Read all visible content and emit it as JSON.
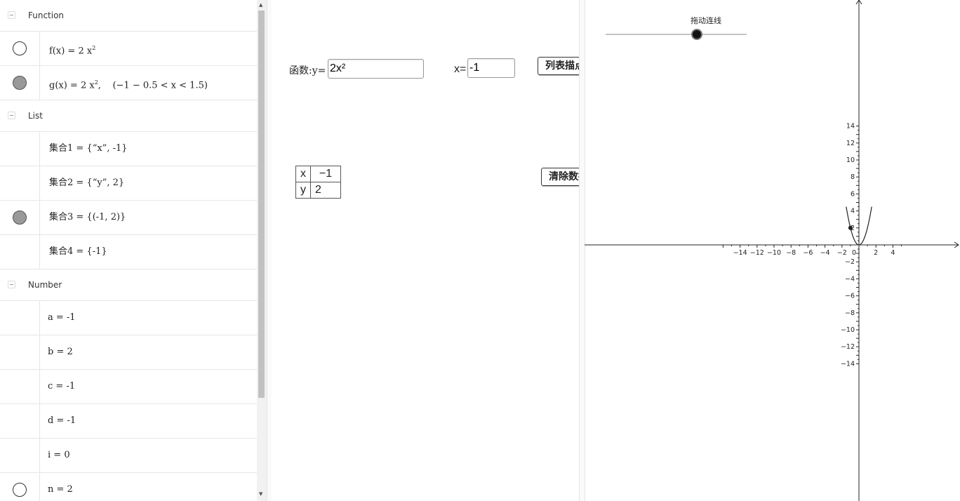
{
  "algebra": {
    "groups": {
      "function": "Function",
      "list": "List",
      "number": "Number"
    },
    "functions": [
      {
        "name": "f(x) = 2 x",
        "exp": "2",
        "rest": "",
        "visible": false
      },
      {
        "name": "g(x) = 2 x",
        "exp": "2",
        "rest": ",    (−1 − 0.5 < x < 1.5)",
        "visible": true
      }
    ],
    "lists": [
      {
        "text": "集合1 = {“x”, -1}",
        "visible": null
      },
      {
        "text": "集合2 = {“y”, 2}",
        "visible": null
      },
      {
        "text": "集合3 = {(-1, 2)}",
        "visible": true
      },
      {
        "text": "集合4 = {-1}",
        "visible": null
      }
    ],
    "numbers": [
      {
        "text": "a = -1",
        "visible": null
      },
      {
        "text": "b = 2",
        "visible": null
      },
      {
        "text": "c = -1",
        "visible": null
      },
      {
        "text": "d = -1",
        "visible": null
      },
      {
        "text": "i = 0",
        "visible": null
      },
      {
        "text": "n = 2",
        "visible": false
      }
    ]
  },
  "panel": {
    "function_label": "函数:y=",
    "function_value": "2x²",
    "x_label": "x=",
    "x_value": "-1",
    "plot_button": "列表描点",
    "clear_button": "清除数据",
    "table": {
      "headers": [
        "x",
        "y"
      ],
      "values": [
        "−1",
        "2"
      ]
    }
  },
  "graph": {
    "slider_caption": "拖动连线",
    "x_ticks": [
      "−14",
      "−12",
      "−10",
      "−8",
      "−6",
      "−4",
      "−2",
      "0",
      "2",
      "4"
    ],
    "y_ticks": [
      "14",
      "12",
      "10",
      "8",
      "6",
      "4",
      "2",
      "−2",
      "−4",
      "−6",
      "−8",
      "−10",
      "−12",
      "−14"
    ],
    "function": "2x^2",
    "domain": [
      -1.5,
      1.5
    ],
    "point": {
      "x": -1,
      "y": 2
    }
  }
}
